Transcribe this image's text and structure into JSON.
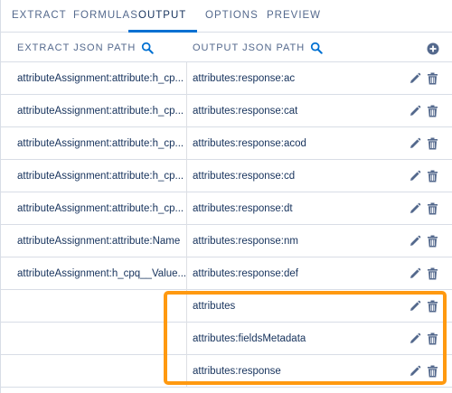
{
  "tabs": [
    {
      "label": "EXTRACT"
    },
    {
      "label": "FORMULAS"
    },
    {
      "label": "OUTPUT"
    },
    {
      "label": "OPTIONS"
    },
    {
      "label": "PREVIEW"
    }
  ],
  "active_tab": "OUTPUT",
  "columns": {
    "extract": "EXTRACT JSON PATH",
    "output": "OUTPUT JSON PATH"
  },
  "rows": [
    {
      "extract": "attributeAssignment:attribute:h_cp...",
      "output": "attributes:response:ac"
    },
    {
      "extract": "attributeAssignment:attribute:h_cp...",
      "output": "attributes:response:cat"
    },
    {
      "extract": "attributeAssignment:attribute:h_cp...",
      "output": "attributes:response:acod"
    },
    {
      "extract": "attributeAssignment:attribute:h_cp...",
      "output": "attributes:response:cd"
    },
    {
      "extract": "attributeAssignment:attribute:h_cp...",
      "output": "attributes:response:dt"
    },
    {
      "extract": "attributeAssignment:attribute:Name",
      "output": "attributes:response:nm"
    },
    {
      "extract": "attributeAssignment:h_cpq__Value...",
      "output": "attributes:response:def"
    },
    {
      "extract": "",
      "output": "attributes"
    },
    {
      "extract": "",
      "output": "attributes:fieldsMetadata"
    },
    {
      "extract": "",
      "output": "attributes:response"
    }
  ],
  "colors": {
    "accent": "#0070d2",
    "highlight": "#ff9910",
    "text": "#16325c",
    "muted": "#54698d",
    "border": "#d8dde6"
  },
  "icons": {
    "search": "search-icon",
    "add": "add-icon",
    "edit": "pencil-icon",
    "delete": "trash-icon"
  }
}
